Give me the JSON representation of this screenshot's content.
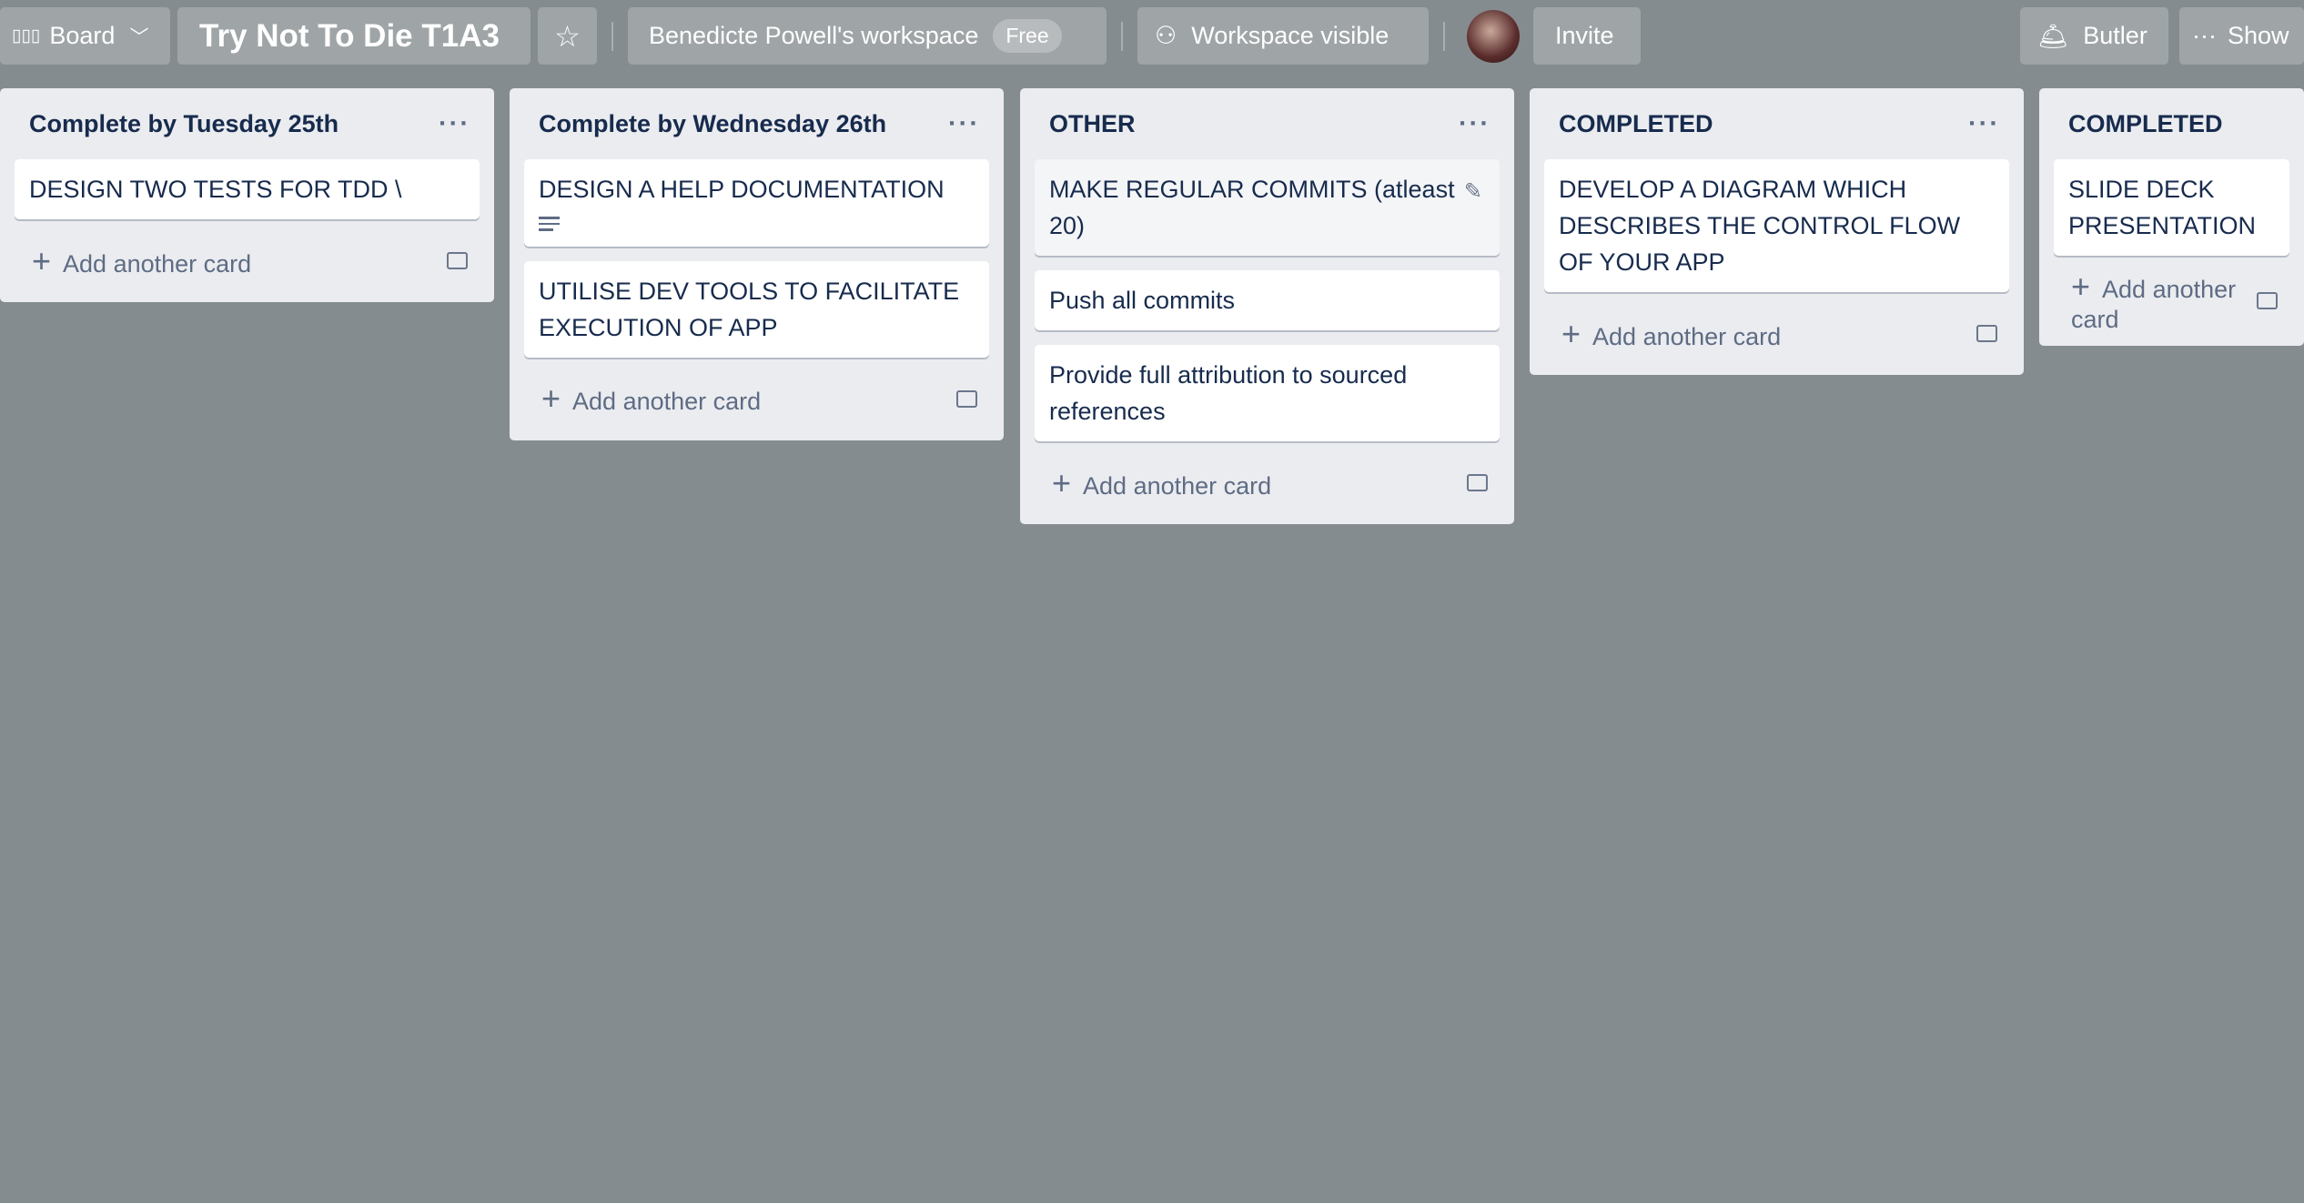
{
  "header": {
    "board_switch": "Board",
    "board_title": "Try Not To Die T1A3",
    "workspace": "Benedicte Powell's workspace",
    "plan_badge": "Free",
    "visibility": "Workspace visible",
    "invite": "Invite",
    "butler": "Butler",
    "show_menu": "Show"
  },
  "add_card_label": "Add another card",
  "lists": [
    {
      "title": "Complete by Tuesday 25th",
      "cards": [
        "DESIGN TWO TESTS FOR TDD \\"
      ]
    },
    {
      "title": "Complete by Wednesday 26th",
      "cards": [
        "DESIGN A HELP DOCUMENTATION",
        "UTILISE DEV TOOLS TO FACILITATE EXECUTION OF APP"
      ]
    },
    {
      "title": "OTHER",
      "cards": [
        "MAKE REGULAR COMMITS (atleast 20)",
        "Push all commits",
        "Provide full attribution to sourced references"
      ]
    },
    {
      "title": "COMPLETED",
      "cards": [
        "DEVELOP A DIAGRAM WHICH DESCRIBES THE CONTROL FLOW OF YOUR APP"
      ]
    },
    {
      "title": "COMPLETED",
      "cards": [
        "SLIDE DECK PRESENTATION"
      ]
    }
  ]
}
